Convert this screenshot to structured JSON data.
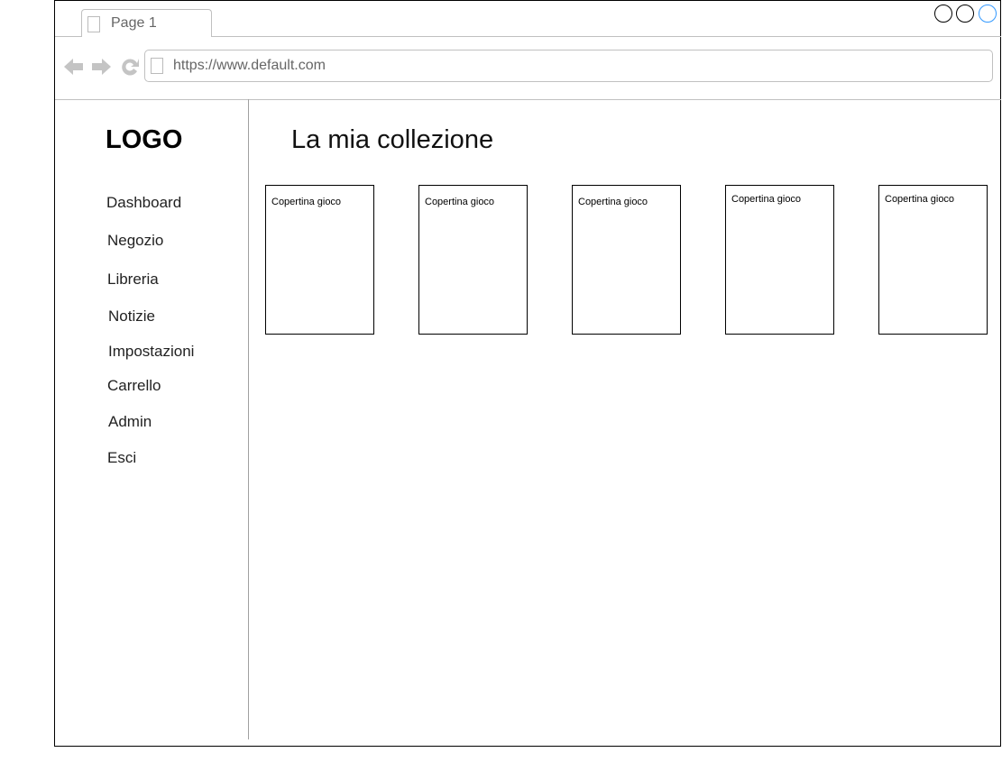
{
  "browser": {
    "tab_title": "Page 1",
    "url": "https://www.default.com",
    "accent": "#3399ff"
  },
  "sidebar": {
    "logo": "LOGO",
    "items": [
      {
        "label": "Dashboard"
      },
      {
        "label": "Negozio"
      },
      {
        "label": "Libreria"
      },
      {
        "label": "Notizie"
      },
      {
        "label": "Impostazioni"
      },
      {
        "label": "Carrello"
      },
      {
        "label": "Admin"
      },
      {
        "label": "Esci"
      }
    ]
  },
  "main": {
    "title": "La mia collezione",
    "cards": [
      {
        "label": "Copertina gioco"
      },
      {
        "label": "Copertina gioco"
      },
      {
        "label": "Copertina gioco"
      },
      {
        "label": "Copertina gioco"
      },
      {
        "label": "Copertina gioco"
      }
    ]
  }
}
